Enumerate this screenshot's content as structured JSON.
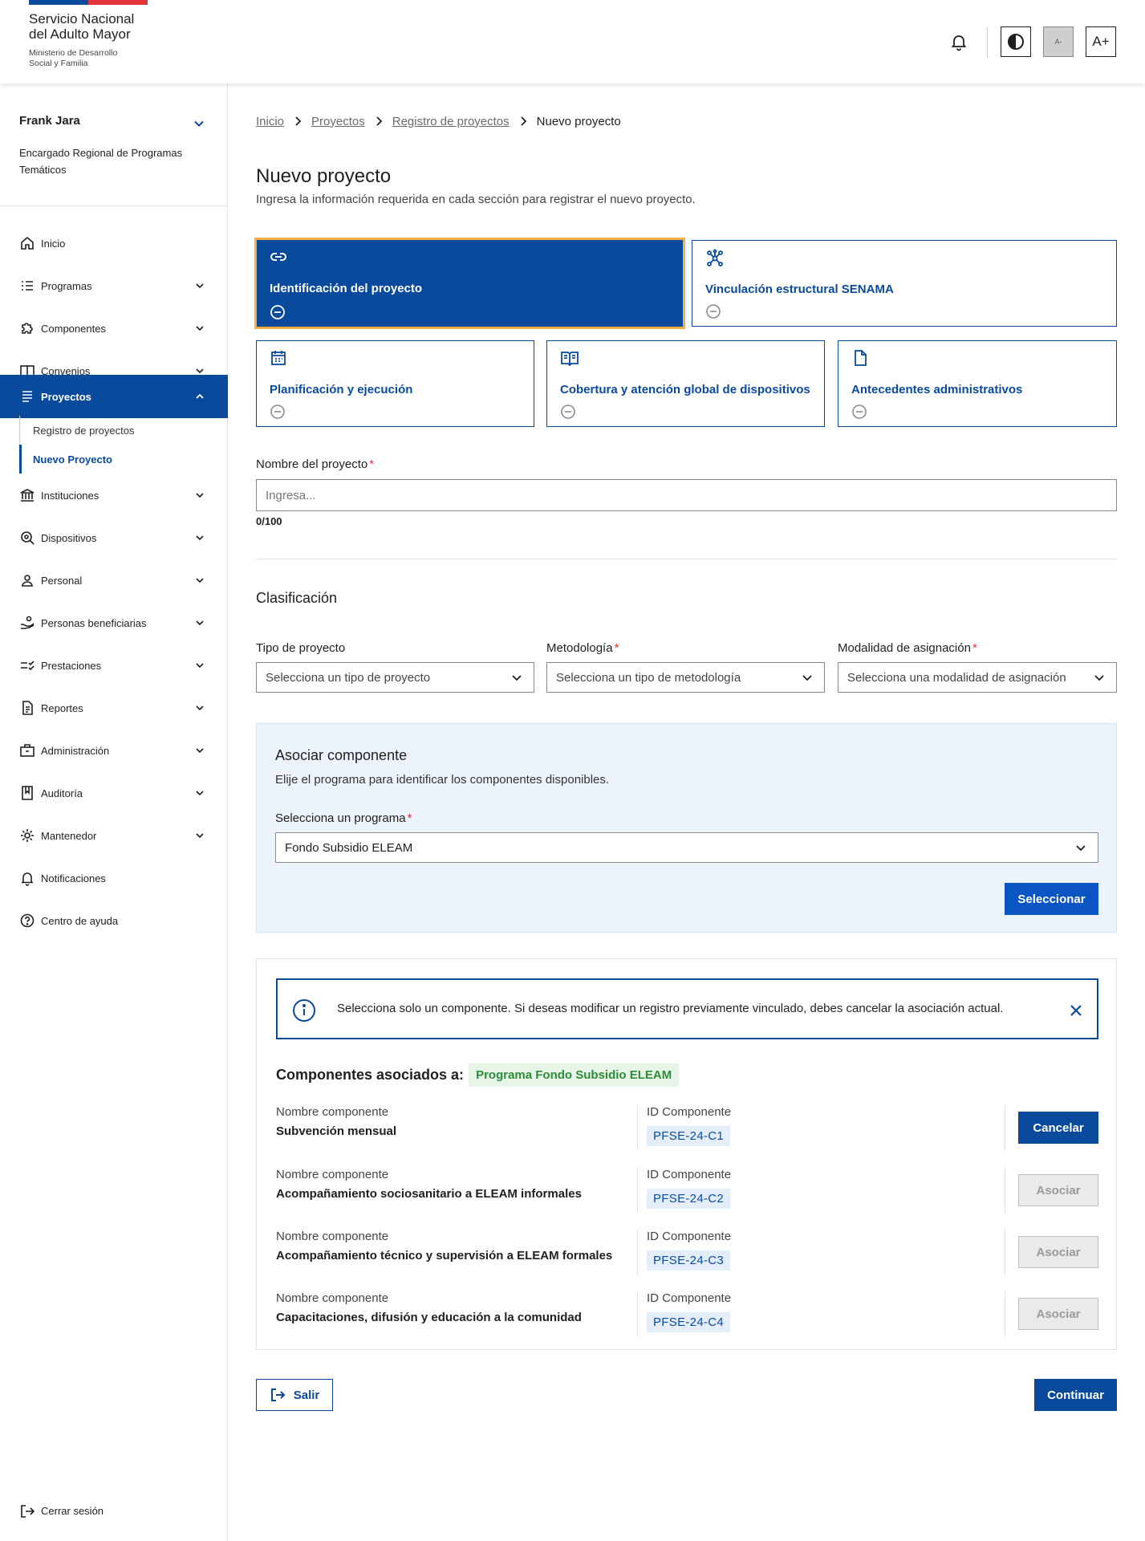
{
  "header": {
    "org_line1": "Servicio Nacional",
    "org_line2": "del Adulto Mayor",
    "ministry_line1": "Ministerio de Desarrollo",
    "ministry_line2": "Social y Familia",
    "font_decrease": "A-",
    "font_increase": "A+"
  },
  "colors": {
    "primary": "#0a4a9c",
    "accent_outline": "#f5b041",
    "flag_red": "#e5343a",
    "success": "#2e8b3a",
    "required": "#d33333"
  },
  "user": {
    "name": "Frank Jara",
    "role": "Encargado Regional de Programas Temáticos"
  },
  "sidebar": {
    "items": [
      {
        "label": "Inicio",
        "icon": "home-icon"
      },
      {
        "label": "Programas",
        "icon": "list-icon"
      },
      {
        "label": "Componentes",
        "icon": "puzzle-icon"
      },
      {
        "label": "Convenios",
        "icon": "book-open-icon"
      },
      {
        "label": "Proyectos",
        "icon": "document-list-icon",
        "active": true
      },
      {
        "label": "Instituciones",
        "icon": "institution-icon"
      },
      {
        "label": "Dispositivos",
        "icon": "device-icon"
      },
      {
        "label": "Personal",
        "icon": "person-icon"
      },
      {
        "label": "Personas beneficiarias",
        "icon": "beneficiary-icon"
      },
      {
        "label": "Prestaciones",
        "icon": "checklist-icon"
      },
      {
        "label": "Reportes",
        "icon": "report-icon"
      },
      {
        "label": "Administración",
        "icon": "briefcase-icon"
      },
      {
        "label": "Auditoría",
        "icon": "audit-icon"
      },
      {
        "label": "Mantenedor",
        "icon": "gear-icon"
      },
      {
        "label": "Notificaciones",
        "icon": "bell-icon"
      },
      {
        "label": "Centro de ayuda",
        "icon": "help-icon"
      }
    ],
    "subitems": [
      {
        "label": "Registro de proyectos"
      },
      {
        "label": "Nuevo Proyecto",
        "current": true
      }
    ],
    "logout": "Cerrar sesión"
  },
  "breadcrumb": [
    "Inicio",
    "Proyectos",
    "Registro de proyectos",
    "Nuevo proyecto"
  ],
  "page": {
    "title": "Nuevo proyecto",
    "description": "Ingresa la información requerida en cada sección para registrar el nuevo proyecto."
  },
  "steps": [
    {
      "label": "Identificación del proyecto",
      "icon": "link-icon",
      "active": true
    },
    {
      "label": "Vinculación estructural SENAMA",
      "icon": "network-icon"
    },
    {
      "label": "Planificación y ejecución",
      "icon": "calendar-icon"
    },
    {
      "label": "Cobertura y atención global de dispositivos",
      "icon": "open-book-icon"
    },
    {
      "label": "Antecedentes administrativos",
      "icon": "file-icon"
    }
  ],
  "form": {
    "project_name_label": "Nombre del proyecto",
    "project_name_placeholder": "Ingresa...",
    "project_name_value": "",
    "counter": "0/100",
    "required_mark": "*",
    "classification_title": "Clasificación",
    "type_label": "Tipo de proyecto",
    "type_value": "Selecciona un tipo de proyecto",
    "methodology_label": "Metodología",
    "methodology_value": "Selecciona un tipo de metodología",
    "modality_label": "Modalidad de asignación",
    "modality_value": "Selecciona una modalidad de asignación"
  },
  "associate": {
    "title": "Asociar componente",
    "description": "Elije el programa para identificar los componentes disponibles.",
    "program_label": "Selecciona un programa",
    "program_value": "Fondo Subsidio ELEAM",
    "select_button": "Seleccionar"
  },
  "components": {
    "alert": "Selecciona solo un componente. Si deseas modificar un registro previamente vinculado, debes cancelar la asociación actual.",
    "heading": "Componentes asociados a:",
    "program_badge": "Programa Fondo Subsidio ELEAM",
    "name_label": "Nombre componente",
    "id_label": "ID Componente",
    "rows": [
      {
        "name": "Subvención mensual",
        "id": "PFSE-24-C1",
        "action": "Cancelar",
        "enabled": true
      },
      {
        "name": "Acompañamiento sociosanitario a ELEAM informales",
        "id": "PFSE-24-C2",
        "action": "Asociar",
        "enabled": false
      },
      {
        "name": "Acompañamiento técnico y supervisión a ELEAM formales",
        "id": "PFSE-24-C3",
        "action": "Asociar",
        "enabled": false
      },
      {
        "name": "Capacitaciones, difusión y educación a la comunidad",
        "id": "PFSE-24-C4",
        "action": "Asociar",
        "enabled": false
      }
    ]
  },
  "footer": {
    "exit_button": "Salir",
    "continue_button": "Continuar"
  }
}
